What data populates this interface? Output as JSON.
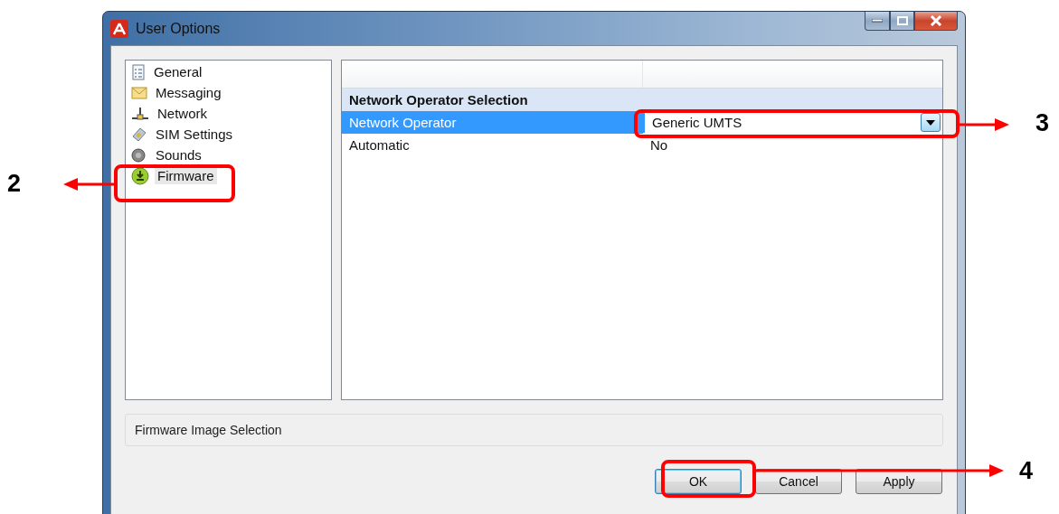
{
  "window": {
    "title": "User Options"
  },
  "sidebar": {
    "items": [
      {
        "label": "General",
        "selected": false
      },
      {
        "label": "Messaging",
        "selected": false
      },
      {
        "label": "Network",
        "selected": false
      },
      {
        "label": "SIM Settings",
        "selected": false
      },
      {
        "label": "Sounds",
        "selected": false
      },
      {
        "label": "Firmware",
        "selected": true
      }
    ]
  },
  "property_grid": {
    "category": "Network Operator Selection",
    "rows": [
      {
        "kind": "dropdown",
        "name": "Network Operator",
        "value": "Generic UMTS",
        "selected": true
      },
      {
        "kind": "text",
        "name": "Automatic",
        "value": "No",
        "selected": false
      }
    ]
  },
  "description": "Firmware Image Selection",
  "buttons": [
    {
      "label": "OK",
      "focused": true
    },
    {
      "label": "Cancel",
      "focused": false
    },
    {
      "label": "Apply",
      "focused": false
    }
  ],
  "callouts": [
    "2",
    "3",
    "4"
  ]
}
